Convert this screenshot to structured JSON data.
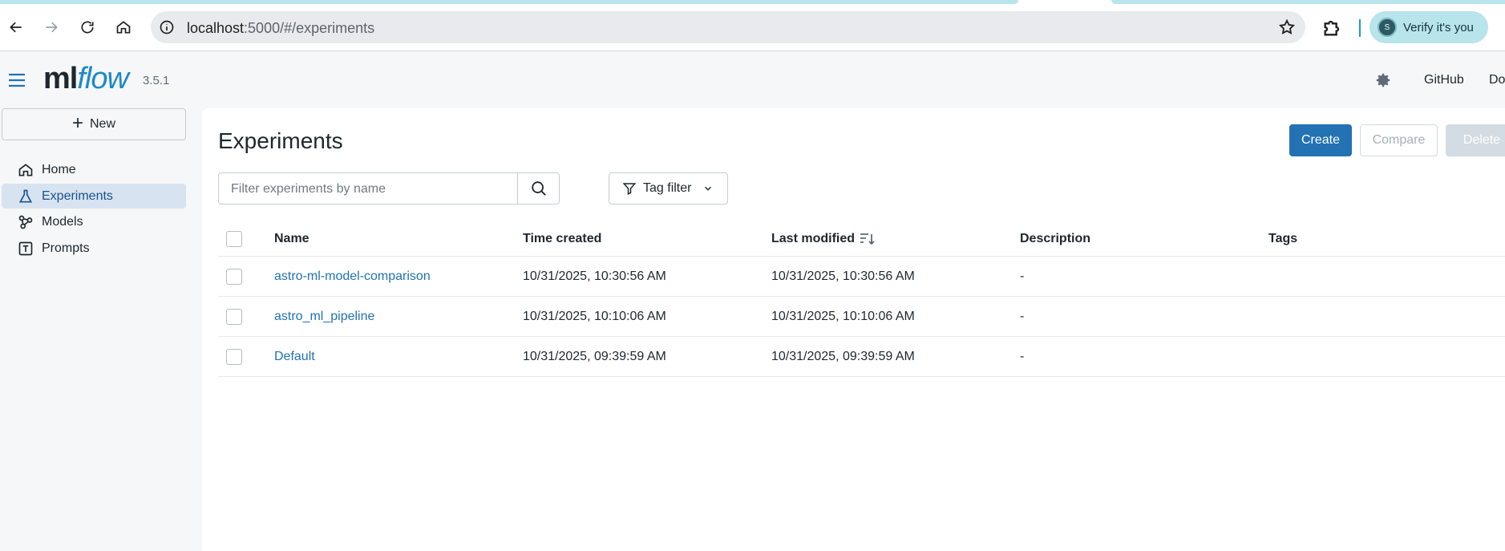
{
  "browser": {
    "url_host": "localhost",
    "url_path": ":5000/#/experiments",
    "verify_label": "Verify it's you",
    "avatar_letter": "S"
  },
  "header": {
    "logo_ml": "ml",
    "logo_flow": "flow",
    "version": "3.5.1",
    "links": [
      "GitHub",
      "Do"
    ]
  },
  "sidebar": {
    "new_label": "New",
    "items": [
      {
        "label": "Home",
        "icon": "home-icon"
      },
      {
        "label": "Experiments",
        "icon": "flask-icon",
        "active": true
      },
      {
        "label": "Models",
        "icon": "models-icon"
      },
      {
        "label": "Prompts",
        "icon": "prompts-icon"
      }
    ]
  },
  "main": {
    "title": "Experiments",
    "buttons": {
      "create": "Create",
      "compare": "Compare",
      "delete": "Delete"
    },
    "search_placeholder": "Filter experiments by name",
    "tag_filter_label": "Tag filter",
    "columns": [
      "Name",
      "Time created",
      "Last modified",
      "Description",
      "Tags"
    ],
    "rows": [
      {
        "name": "astro-ml-model-comparison",
        "created": "10/31/2025, 10:30:56 AM",
        "modified": "10/31/2025, 10:30:56 AM",
        "description": "-",
        "tags": ""
      },
      {
        "name": "astro_ml_pipeline",
        "created": "10/31/2025, 10:10:06 AM",
        "modified": "10/31/2025, 10:10:06 AM",
        "description": "-",
        "tags": ""
      },
      {
        "name": "Default",
        "created": "10/31/2025, 09:39:59 AM",
        "modified": "10/31/2025, 09:39:59 AM",
        "description": "-",
        "tags": ""
      }
    ]
  },
  "colors": {
    "accent": "#2272b4",
    "sidebar_active_bg": "#d7e3f0",
    "browser_tab": "#b8e4ec"
  }
}
